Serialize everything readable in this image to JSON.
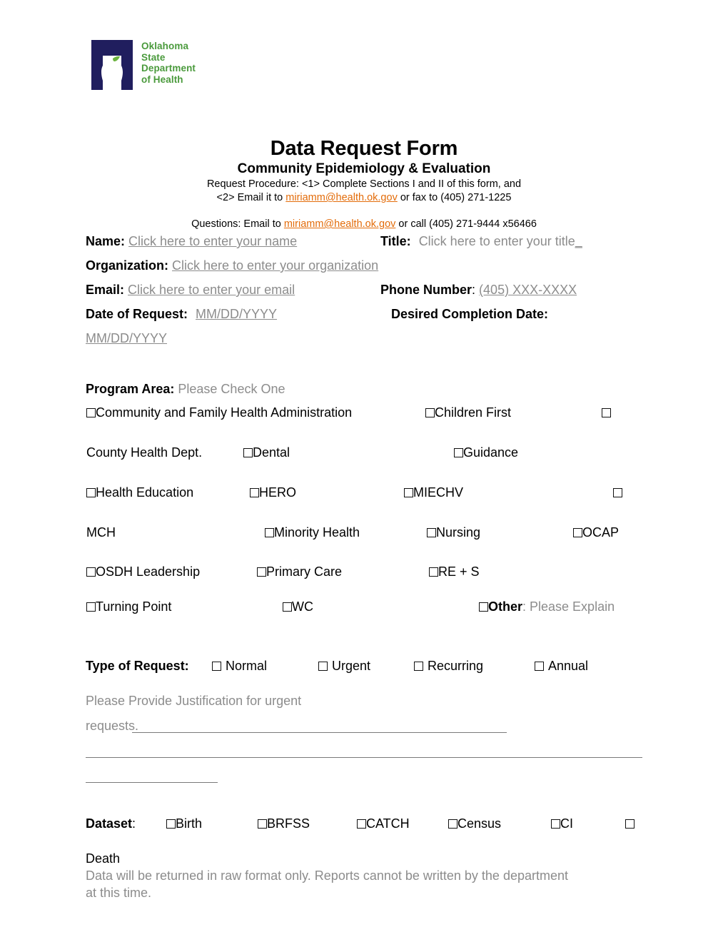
{
  "logo": {
    "line1": "Oklahoma",
    "line2": "State",
    "line3": "Department",
    "line4": "of Health",
    "navy": "#201E5E",
    "green": "#4a9a3c"
  },
  "header": {
    "title": "Data Request Form",
    "subtitle": "Community Epidemiology & Evaluation",
    "procedure_line1": "Request Procedure: <1> Complete Sections I and II of this form, and",
    "procedure_line2_pre": "<2> Email it to ",
    "procedure_email": "miriamm@health.ok.gov",
    "procedure_line2_post": " or fax to (405) 271-1225",
    "questions_pre": "Questions: Email to ",
    "questions_email": "miriamm@health.ok.gov",
    "questions_post": " or call (405) 271-9444 x56466",
    "link_color": "#E36C0A"
  },
  "fields": {
    "name_label": "Name:",
    "name_placeholder": "Click here to enter your name",
    "title_label": "Title:",
    "title_placeholder": "Click here to enter your title",
    "title_trailing": "_",
    "organization_label": "Organization:",
    "organization_placeholder": "Click here to enter your organization",
    "organization_trailing": " ",
    "email_label": "Email:",
    "email_placeholder": "Click here to enter your email",
    "phone_label": "Phone Number",
    "phone_label_colon": ":",
    "phone_placeholder": "(405) XXX-XXXX",
    "date_request_label": "Date of Request:",
    "date_request_placeholder": "MM/DD/YYYY",
    "desired_completion_label": "Desired Completion Date:",
    "desired_completion_placeholder": "MM/DD/YYYY"
  },
  "program_area": {
    "label": "Program Area:",
    "hint": "Please Check One",
    "row1": {
      "c1": "Community and Family Health Administration",
      "c2": "Children First",
      "c3": ""
    },
    "row2": {
      "c1": "County Health Dept.",
      "c2": "Dental",
      "c3": "Guidance"
    },
    "row3": {
      "c1": "Health Education",
      "c2": "HERO",
      "c3": "MIECHV",
      "c4": ""
    },
    "row4": {
      "c1": "MCH",
      "c2": "Minority Health",
      "c3": "Nursing",
      "c4": "OCAP"
    },
    "row5": {
      "c1": "OSDH Leadership",
      "c2": "Primary Care",
      "c3": "RE + S"
    },
    "row6": {
      "c1": "Turning Point",
      "c2": "WC",
      "c3_bold": "Other",
      "c3_hint": ": Please Explain"
    }
  },
  "type_of_request": {
    "label": "Type of Request:",
    "options": [
      "Normal",
      "Urgent",
      "Recurring",
      "Annual"
    ],
    "justification_line1": "Please Provide Justification for urgent",
    "justification_line2": "requests.",
    "justification_fill": "________________________________________________"
  },
  "dataset": {
    "label": "Dataset",
    "label_colon": ":",
    "options": [
      "Birth",
      "BRFSS",
      "CATCH",
      "Census",
      "CI"
    ],
    "trailing_option": "Death",
    "note_line1": "Data will be returned in raw format only.   Reports cannot be written by the department",
    "note_line2": "at this time."
  }
}
